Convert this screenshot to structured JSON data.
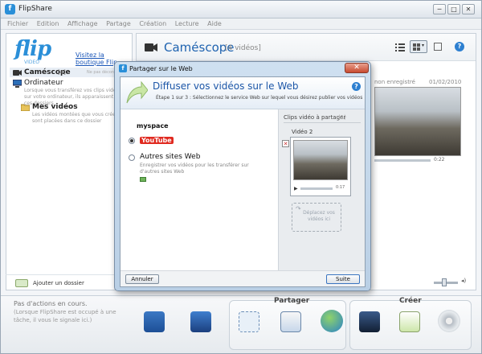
{
  "app": {
    "title": "FlipShare",
    "icon": "flip-app-icon"
  },
  "window_controls": [
    "─",
    "□",
    "✕"
  ],
  "menu": [
    "Fichier",
    "Edition",
    "Affichage",
    "Partage",
    "Création",
    "Lecture",
    "Aide"
  ],
  "sidebar": {
    "logo": "flip",
    "logo_sub": "VIDEO",
    "shop_link": "Visitez la boutique Flip",
    "camcorder": {
      "label": "Caméscope",
      "count": "[4]",
      "note": "Ne pas déconnecter"
    },
    "computer": {
      "label": "Ordinateur",
      "desc": "Lorsque vous transférez vos clips vidéo sur votre ordinateur, ils apparaissent dans ces dossiers"
    },
    "my_videos": {
      "label": "Mes vidéos",
      "desc": "Les vidéos montées que vous créez sont placées dans ce dossier"
    },
    "add_folder": "Ajouter un dossier"
  },
  "main": {
    "title": "Caméscope",
    "count": "[4 vidéos]",
    "video_label": "non enregistré",
    "video_date": "01/02/2010",
    "video_time": "0:22"
  },
  "status": {
    "line1": "Pas d'actions en cours.",
    "line2": "(Lorsque FlipShare est occupé à une tâche, il vous le signale ici.)"
  },
  "groups": {
    "share": "Partager",
    "create": "Créer"
  },
  "dialog": {
    "title": "Partager sur le Web",
    "close": "✕",
    "heading": "Diffuser vos vidéos sur le Web",
    "step": "Étape 1 sur 3 : Sélectionnez le service Web sur lequel vous désirez publier vos vidéos",
    "services": [
      {
        "name": "myspace",
        "selected": false
      },
      {
        "name": "YouTube",
        "selected": true
      },
      {
        "name": "Autres sites Web",
        "selected": false,
        "desc": "Enregistrer vos vidéos pour les transférer sur d'autres sites Web"
      }
    ],
    "clips_title": "Clips vidéo à partager",
    "clips_count": "(1)",
    "clip_name": "Vidéo 2",
    "clip_time": "0:17",
    "drop_hint": "Déplacez vos vidéos ici",
    "cancel": "Annuler",
    "next": "Suite"
  },
  "colors": {
    "accent": "#1f63b0",
    "brand": "#2b8fd8",
    "youtube_red": "#e02a20"
  }
}
